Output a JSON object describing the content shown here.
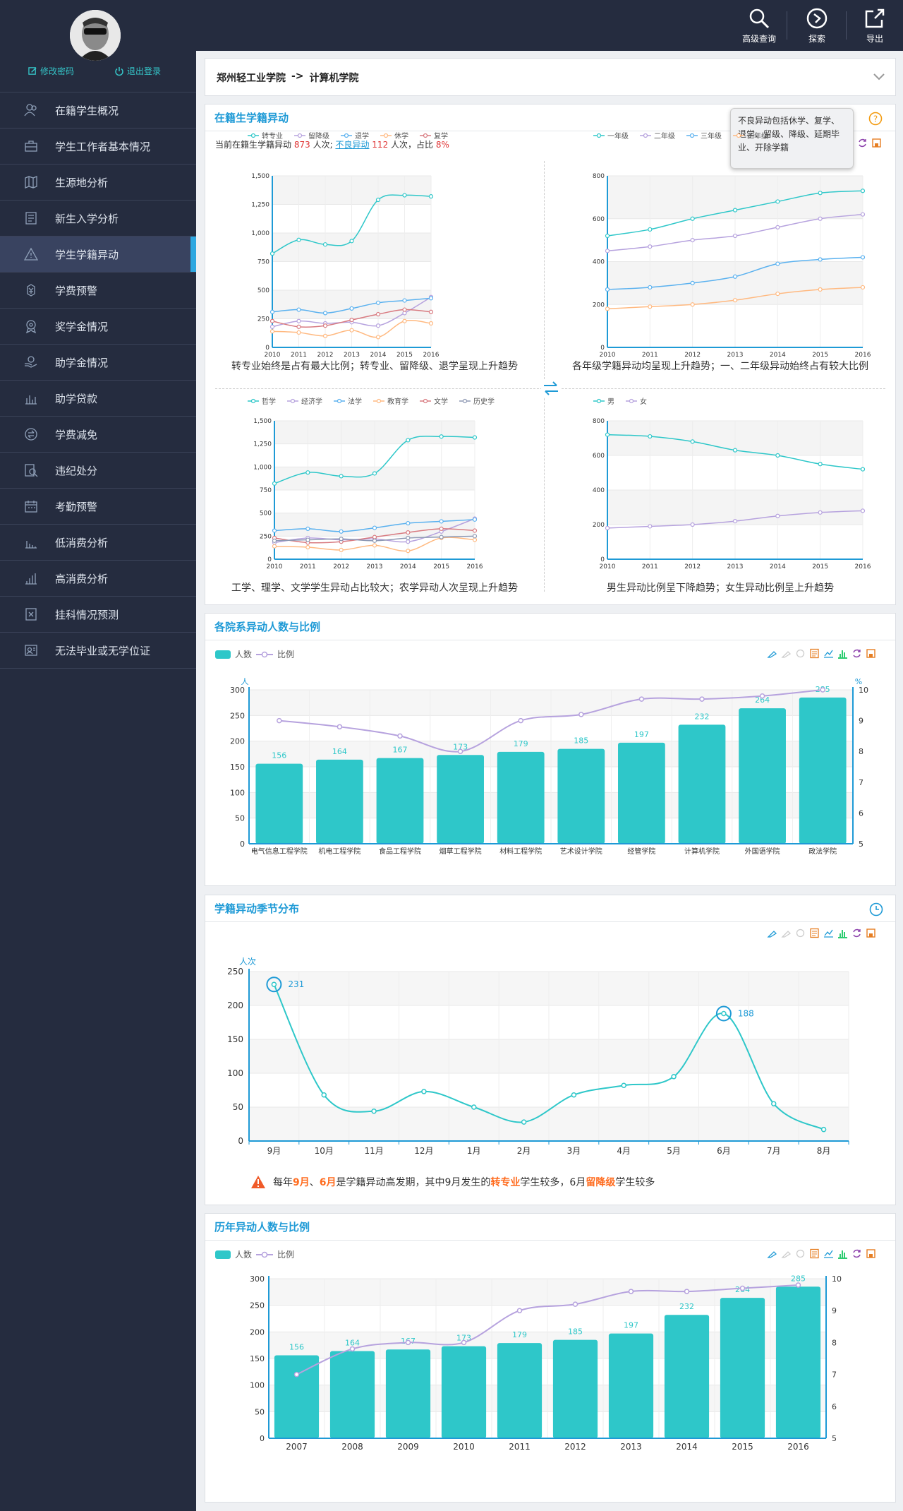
{
  "sidebar": {
    "change_password": "修改密码",
    "logout": "退出登录",
    "items": [
      {
        "label": "在籍学生概况",
        "icon": "people-icon"
      },
      {
        "label": "学生工作者基本情况",
        "icon": "briefcase-icon"
      },
      {
        "label": "生源地分析",
        "icon": "map-icon"
      },
      {
        "label": "新生入学分析",
        "icon": "notepad-icon"
      },
      {
        "label": "学生学籍异动",
        "icon": "warning-icon",
        "active": true
      },
      {
        "label": "学费预警",
        "icon": "yuan-icon"
      },
      {
        "label": "奖学金情况",
        "icon": "medal-icon"
      },
      {
        "label": "助学金情况",
        "icon": "hand-coin-icon"
      },
      {
        "label": "助学贷款",
        "icon": "loan-chart-icon"
      },
      {
        "label": "学费减免",
        "icon": "exchange-icon"
      },
      {
        "label": "违纪处分",
        "icon": "search-doc-icon"
      },
      {
        "label": "考勤预警",
        "icon": "calendar-icon"
      },
      {
        "label": "低消费分析",
        "icon": "low-bars-icon"
      },
      {
        "label": "高消费分析",
        "icon": "high-bars-icon"
      },
      {
        "label": "挂科情况预测",
        "icon": "book-x-icon"
      },
      {
        "label": "无法毕业或无学位证",
        "icon": "id-card-icon"
      }
    ]
  },
  "topbar": {
    "advanced_query": "高级查询",
    "explore": "探索",
    "export": "导出"
  },
  "breadcrumb": {
    "root": "郑州轻工业学院",
    "arrow": "->",
    "current": "计算机学院"
  },
  "panel1": {
    "title": "在籍生学籍异动",
    "summary_prefix": "当前在籍生学籍异动",
    "total": "873",
    "unit1": "人次;",
    "bad_link": "不良异动",
    "bad_count": "112",
    "unit2": "人次，占比",
    "ratio": "8%",
    "tooltip": "不良异动包括休学、复学、退学、留级、降级、延期毕业、开除学籍",
    "captions": [
      "转专业始终是占有最大比例；转专业、留降级、退学呈现上升趋势",
      "各年级学籍异动均呈现上升趋势；一、二年级异动始终占有较大比例",
      "工学、理学、文学学生异动占比较大；农学异动人次呈现上升趋势",
      "男生异动比例呈下降趋势；女生异动比例呈上升趋势"
    ]
  },
  "panel2": {
    "title": "各院系异动人数与比例",
    "legend_people": "人数",
    "legend_ratio": "比例"
  },
  "panel3": {
    "title": "学籍异动季节分布",
    "note_prefix": "每年",
    "note_m1": "9月",
    "note_sep": "、",
    "note_m2": "6月",
    "note_mid": "是学籍异动高发期，其中9月发生的",
    "note_h1": "转专业",
    "note_mid2": "学生较多，6月",
    "note_h2": "留降级",
    "note_end": "学生较多"
  },
  "panel4": {
    "title": "历年异动人数与比例",
    "legend_people": "人数",
    "legend_ratio": "比例"
  },
  "colors": {
    "teal": "#2ec7c9",
    "purple": "#b6a2de",
    "blue": "#5ab1ef",
    "orange": "#ffb980",
    "red": "#d87a80",
    "gray": "#8d98b3",
    "title_blue": "#1e9ad6",
    "highlight": "#ff6c1f"
  },
  "chart_data": [
    {
      "type": "line",
      "x": [
        "2010",
        "2011",
        "2012",
        "2013",
        "2014",
        "2015",
        "2016"
      ],
      "ylim": [
        0,
        1500
      ],
      "yticks": [
        0,
        250,
        500,
        750,
        "1,000",
        "1,250",
        "1,500"
      ],
      "series": [
        {
          "name": "转专业",
          "values": [
            820,
            940,
            900,
            930,
            1290,
            1330,
            1320
          ]
        },
        {
          "name": "留降级",
          "values": [
            180,
            230,
            210,
            220,
            190,
            300,
            440
          ]
        },
        {
          "name": "退学",
          "values": [
            310,
            330,
            300,
            340,
            390,
            410,
            430
          ]
        },
        {
          "name": "休学",
          "values": [
            140,
            130,
            100,
            150,
            90,
            230,
            210
          ]
        },
        {
          "name": "复学",
          "values": [
            230,
            180,
            190,
            240,
            290,
            330,
            310
          ]
        }
      ]
    },
    {
      "type": "line",
      "x": [
        "2010",
        "2011",
        "2012",
        "2013",
        "2014",
        "2015",
        "2016"
      ],
      "ylim": [
        0,
        800
      ],
      "yticks": [
        0,
        200,
        400,
        600,
        800
      ],
      "series": [
        {
          "name": "一年级",
          "values": [
            520,
            550,
            600,
            640,
            680,
            720,
            730
          ]
        },
        {
          "name": "二年级",
          "values": [
            450,
            470,
            500,
            520,
            560,
            600,
            620
          ]
        },
        {
          "name": "三年级",
          "values": [
            270,
            280,
            300,
            330,
            390,
            410,
            420
          ]
        },
        {
          "name": "四年级",
          "values": [
            180,
            190,
            200,
            220,
            250,
            270,
            280
          ]
        }
      ]
    },
    {
      "type": "line",
      "x": [
        "2010",
        "2011",
        "2012",
        "2013",
        "2014",
        "2015",
        "2016"
      ],
      "ylim": [
        0,
        1500
      ],
      "yticks": [
        0,
        250,
        500,
        750,
        "1,000",
        "1,250",
        "1,500"
      ],
      "series": [
        {
          "name": "哲学",
          "values": [
            820,
            940,
            900,
            930,
            1290,
            1330,
            1320
          ]
        },
        {
          "name": "经济学",
          "values": [
            180,
            230,
            210,
            220,
            190,
            300,
            440
          ]
        },
        {
          "name": "法学",
          "values": [
            310,
            330,
            300,
            340,
            390,
            410,
            430
          ]
        },
        {
          "name": "教育学",
          "values": [
            140,
            130,
            100,
            150,
            90,
            230,
            210
          ]
        },
        {
          "name": "文学",
          "values": [
            230,
            180,
            190,
            240,
            290,
            330,
            310
          ]
        },
        {
          "name": "历史学",
          "values": [
            200,
            210,
            220,
            200,
            230,
            240,
            250
          ]
        }
      ]
    },
    {
      "type": "line",
      "x": [
        "2010",
        "2011",
        "2012",
        "2013",
        "2014",
        "2015",
        "2016"
      ],
      "ylim": [
        0,
        800
      ],
      "yticks": [
        0,
        200,
        400,
        600,
        800
      ],
      "series": [
        {
          "name": "男",
          "values": [
            720,
            710,
            680,
            630,
            600,
            550,
            520
          ]
        },
        {
          "name": "女",
          "values": [
            180,
            190,
            200,
            220,
            250,
            270,
            280
          ]
        }
      ]
    },
    {
      "type": "bar",
      "categories": [
        "电气信息工程学院",
        "机电工程学院",
        "食品工程学院",
        "烟草工程学院",
        "材料工程学院",
        "艺术设计学院",
        "经管学院",
        "计算机学院",
        "外国语学院",
        "政法学院"
      ],
      "ylabel": "人",
      "y2label": "%",
      "ylim": [
        0,
        300
      ],
      "yticks": [
        0,
        50,
        100,
        150,
        200,
        250,
        300
      ],
      "y2lim": [
        5,
        10
      ],
      "y2ticks": [
        5,
        6,
        7,
        8,
        9,
        10
      ],
      "series": [
        {
          "name": "人数",
          "values": [
            156,
            164,
            167,
            173,
            179,
            185,
            197,
            232,
            264,
            285
          ],
          "labels": [
            156,
            164,
            167,
            173,
            179,
            185,
            197,
            232,
            264,
            285
          ]
        },
        {
          "name": "比例",
          "values": [
            9.0,
            8.8,
            8.5,
            8.0,
            9.0,
            9.2,
            9.7,
            9.7,
            9.8,
            10.0
          ]
        }
      ]
    },
    {
      "type": "line",
      "x": [
        "9月",
        "10月",
        "11月",
        "12月",
        "1月",
        "2月",
        "3月",
        "4月",
        "5月",
        "6月",
        "7月",
        "8月"
      ],
      "ylabel": "人次",
      "ylim": [
        0,
        250
      ],
      "yticks": [
        0,
        50,
        100,
        150,
        200,
        250
      ],
      "series": [
        {
          "name": "",
          "values": [
            231,
            68,
            44,
            73,
            50,
            28,
            68,
            82,
            95,
            188,
            55,
            17
          ]
        }
      ],
      "markers": [
        {
          "label": "231",
          "index": 0
        },
        {
          "label": "188",
          "index": 9
        }
      ]
    },
    {
      "type": "bar",
      "categories": [
        "2007",
        "2008",
        "2009",
        "2010",
        "2011",
        "2012",
        "2013",
        "2014",
        "2015",
        "2016"
      ],
      "ylim": [
        0,
        300
      ],
      "yticks": [
        0,
        50,
        100,
        150,
        200,
        250,
        300
      ],
      "y2lim": [
        5,
        10
      ],
      "y2ticks": [
        5,
        6,
        7,
        8,
        9,
        10
      ],
      "series": [
        {
          "name": "人数",
          "values": [
            156,
            164,
            167,
            173,
            179,
            185,
            197,
            232,
            264,
            285
          ],
          "labels": [
            156,
            164,
            167,
            173,
            179,
            185,
            197,
            232,
            264,
            285
          ]
        },
        {
          "name": "比例",
          "values": [
            7.0,
            7.8,
            8.0,
            8.0,
            9.0,
            9.2,
            9.6,
            9.6,
            9.7,
            9.8
          ]
        }
      ]
    }
  ]
}
